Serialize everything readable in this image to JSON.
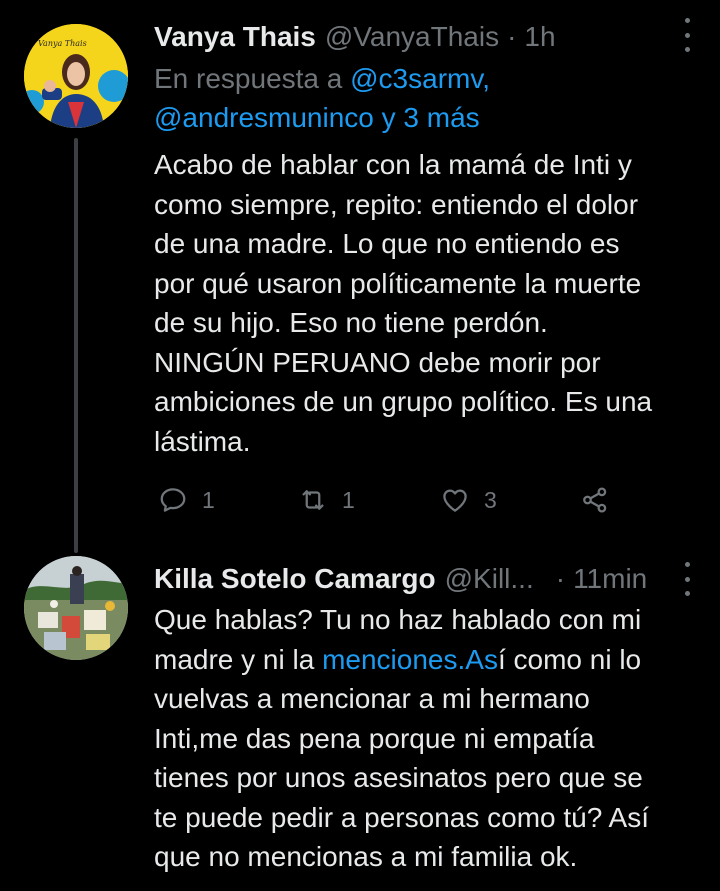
{
  "tweets": [
    {
      "name": "Vanya Thais",
      "handle": "@VanyaThais",
      "separator": "·",
      "time": "1h",
      "avatar_label": "Vanya Thais",
      "replying_prefix": "En respuesta a",
      "replying_to_1": "@c3sarmv,",
      "replying_to_2": "@andresmuninco y 3 más",
      "lines": [
        "Acabo de hablar con la mamá de Inti y",
        "como siempre, repito: entiendo el dolor",
        "de una madre. Lo que no entiendo es",
        "por qué usaron políticamente la muerte",
        "de su hijo. Eso no tiene perdón.",
        "NINGÚN PERUANO debe morir por",
        "ambiciones de un grupo político. Es una",
        "lástima."
      ],
      "replies": "1",
      "retweets": "1",
      "likes": "3"
    },
    {
      "name": "Killa Sotelo Camargo",
      "handle": "@Kill...",
      "separator": "·",
      "time": "11min",
      "line1": "Que hablas? Tu no haz hablado con mi",
      "line2_before": "madre y ni la ",
      "line2_link": "menciones.As",
      "line2_after": "í como ni lo",
      "lines_rest": [
        "vuelvas a mencionar a mi hermano",
        "Inti,me das pena porque ni empatía",
        "tienes por unos asesinatos  pero que se",
        "te puede pedir a personas como tú? Así",
        "que no mencionas a mi familia ok."
      ]
    }
  ],
  "colors": {
    "background": "#000000",
    "text": "#e7e9ea",
    "secondary": "#71767b",
    "link": "#1d9bf0",
    "avatar_bg": "#f5d51b"
  },
  "icons": [
    "reply-icon",
    "retweet-icon",
    "like-icon",
    "share-icon",
    "more-icon"
  ]
}
